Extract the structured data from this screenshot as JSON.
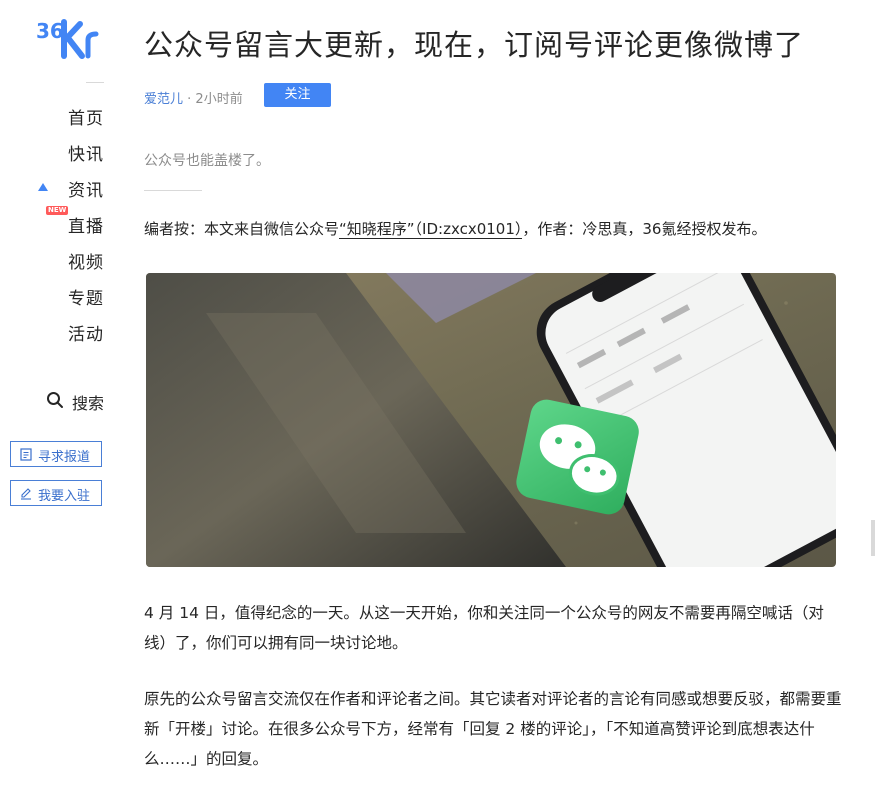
{
  "sidebar": {
    "logo_text": "36Kr",
    "nav_items": [
      {
        "label": "首页",
        "active": false,
        "badge": ""
      },
      {
        "label": "快讯",
        "active": false,
        "badge": ""
      },
      {
        "label": "资讯",
        "active": true,
        "badge": ""
      },
      {
        "label": "直播",
        "active": false,
        "badge": "NEW"
      },
      {
        "label": "视频",
        "active": false,
        "badge": ""
      },
      {
        "label": "专题",
        "active": false,
        "badge": ""
      },
      {
        "label": "活动",
        "active": false,
        "badge": ""
      }
    ],
    "search_label": "搜索",
    "report_button": "寻求报道",
    "join_button": "我要入驻"
  },
  "article": {
    "title": "公众号留言大更新，现在，订阅号评论更像微博了",
    "author": "爱范儿",
    "time": "· 2小时前",
    "follow_button": "关注",
    "summary": "公众号也能盖楼了。",
    "editor_note_prefix": "编者按：本文来自微信公众号",
    "editor_note_source": "“知晓程序”（ID:zxcx0101）",
    "editor_note_suffix": "，作者：冷思真，36氪经授权发布。",
    "paragraphs": [
      "4 月 14 日，值得纪念的一天。从这一天开始，你和关注同一个公众号的网友不需要再隔空喊话（对线）了，你们可以拥有同一块讨论地。",
      "原先的公众号留言交流仅在作者和评论者之间。其它读者对评论者的言论有同感或想要反驳，都需要重新「开楼」讨论。在很多公众号下方，经常有「回复 2 楼的评论」，「不知道高赞评论到底想表达什么……」的回复。"
    ]
  },
  "colors": {
    "accent": "#4285f4",
    "brand": "#4285f4",
    "wechat_green": "#3fbf6f"
  }
}
